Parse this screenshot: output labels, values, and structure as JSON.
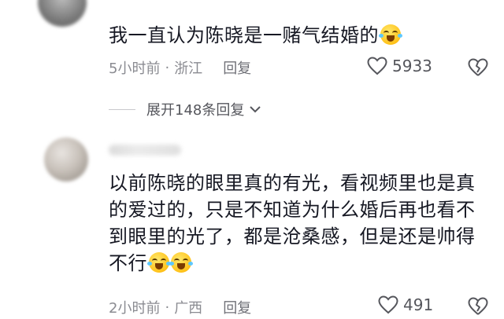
{
  "comments": [
    {
      "text": "我一直认为陈晓是一赌气结婚的",
      "emoji": "crying-laughing-emoji",
      "time": "5小时前",
      "location": "浙江",
      "reply_label": "回复",
      "likes": "5933"
    },
    {
      "text": "以前陈晓的眼里真的有光，看视频里也是真的爱过的，只是不知道为什么婚后再也看不到眼里的光了，都是沧桑感，但是还是帅得不行",
      "emoji": "laughing-tears-emoji x2",
      "time": "2小时前",
      "location": "广西",
      "reply_label": "回复",
      "likes": "491"
    }
  ],
  "expand_replies": {
    "label": "展开148条回复"
  },
  "colors": {
    "text": "#161823",
    "meta": "#8a8b91",
    "icon": "#55565c"
  }
}
